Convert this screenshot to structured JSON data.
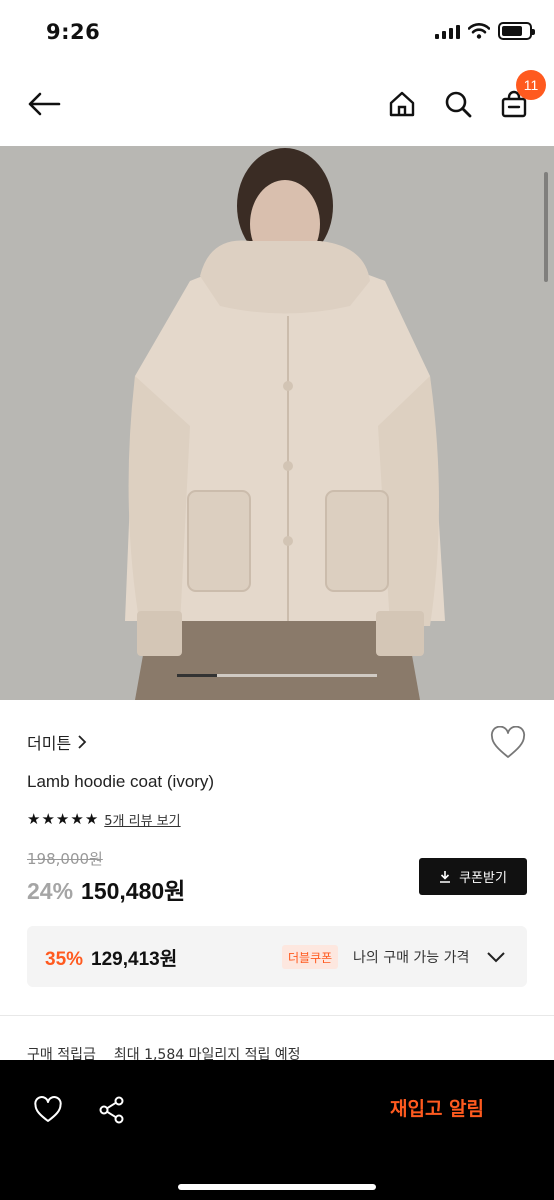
{
  "status": {
    "time": "9:26",
    "battery_level": 0.75
  },
  "header": {
    "cart_count": "11",
    "icons": [
      "back-arrow-icon",
      "home-icon",
      "search-icon",
      "cart-icon"
    ]
  },
  "hero": {
    "carousel_progress": 0.2
  },
  "product": {
    "brand": "더미튼",
    "name": "Lamb hoodie coat (ivory)",
    "rating_stars": 5,
    "review_link": "5개 리뷰 보기",
    "original_price": "198,000원",
    "discount_rate": "24%",
    "sale_price": "150,480원",
    "coupon_button": "쿠폰받기"
  },
  "best_price": {
    "discount_rate": "35%",
    "price": "129,413원",
    "tag": "더블쿠폰",
    "label": "나의 구매 가능 가격"
  },
  "points": {
    "label": "구매 적립금",
    "value": "최대 1,584 마일리지 적립 예정"
  },
  "bottom_bar": {
    "restock_label": "재입고 알림"
  },
  "colors": {
    "accent": "#ff5a1f",
    "dark": "#111111",
    "muted": "#999999"
  }
}
